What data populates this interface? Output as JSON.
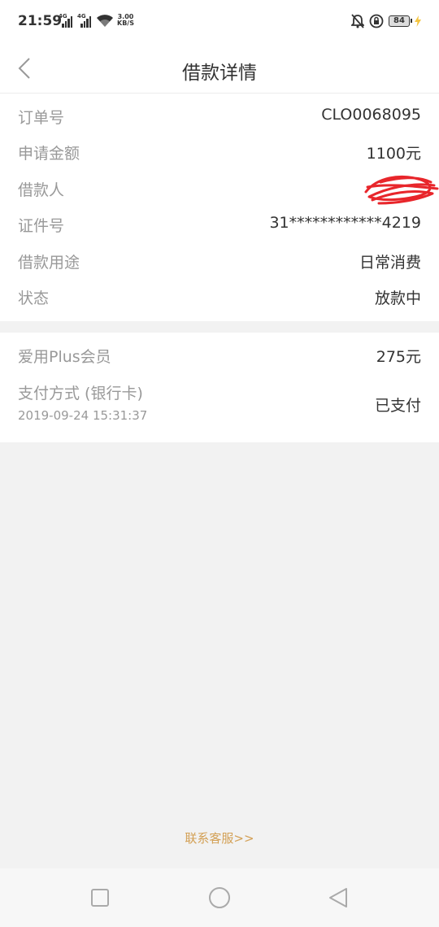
{
  "status_bar": {
    "time": "21:59",
    "sim1": "4G",
    "sim2": "4G",
    "speed_value": "3.00",
    "speed_unit": "KB/S",
    "battery": "84",
    "battery_color": "#f4c542"
  },
  "header": {
    "title": "借款详情",
    "back_icon": "chevron-left-icon"
  },
  "loan": {
    "rows": [
      {
        "label": "订单号",
        "value": "CLO0068095"
      },
      {
        "label": "申请金额",
        "value": "1100元"
      },
      {
        "label": "借款人",
        "value": ""
      },
      {
        "label": "证件号",
        "value": "31************4219"
      },
      {
        "label": "借款用途",
        "value": "日常消费"
      },
      {
        "label": "状态",
        "value": "放款中"
      }
    ]
  },
  "membership": {
    "label": "爱用Plus会员",
    "value": "275元",
    "payment_label": "支付方式 (银行卡)",
    "payment_date": "2019-09-24 15:31:37",
    "payment_status": "已支付"
  },
  "footer": {
    "contact_link": "联系客服>>",
    "contact_color": "#d3a055"
  },
  "system_nav": {
    "keys": [
      "square-recent-icon",
      "circle-home-icon",
      "triangle-back-icon"
    ]
  }
}
